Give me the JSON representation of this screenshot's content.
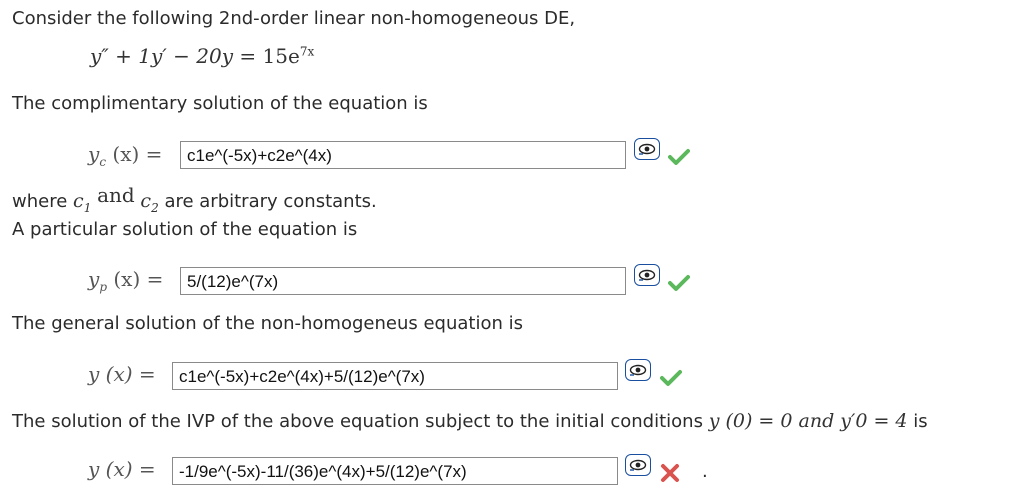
{
  "intro": "Consider the following 2nd-order linear non-homogeneous DE,",
  "de": {
    "lhs": "y″ + 1y′ − 20y",
    "eq": "=",
    "rhs_coeff": "15e",
    "rhs_exp": "7x"
  },
  "complementary": {
    "prompt": "The complimentary solution of the equation is",
    "lhs_main": "y",
    "lhs_sub": "c",
    "lhs_arg": "(x) =",
    "value": "c1e^(-5x)+c2e^(4x)",
    "status": "correct"
  },
  "constants": {
    "where": "where",
    "c1": "c",
    "c1_sub": "1",
    "and": "and",
    "c2": "c",
    "c2_sub": "2",
    "tail": "are arbitrary constants."
  },
  "particular": {
    "prompt": "A particular solution of the equation is",
    "lhs_main": "y",
    "lhs_sub": "p",
    "lhs_arg": "(x) =",
    "value": "5/(12)e^(7x)",
    "status": "correct"
  },
  "general": {
    "prompt": "The general solution of the non-homogeneus equation is",
    "lhs": "y (x) =",
    "value": "c1e^(-5x)+c2e^(4x)+5/(12)e^(7x)",
    "status": "correct"
  },
  "ivp": {
    "prompt": "The solution of the IVP of the above equation subject to the initial conditions",
    "conditions": "y (0) = 0 and y′0 = 4",
    "tail": "is",
    "lhs": "y (x) =",
    "value": "-1/9e^(-5x)-11/(36)e^(4x)+5/(12)e^(7x)",
    "status": "incorrect",
    "period": "."
  },
  "colors": {
    "correct": "#5cb85c",
    "incorrect": "#d9534f",
    "preview_border": "#1a4fa0"
  },
  "icons": {
    "preview": "eye-preview-icon",
    "correct": "checkmark-icon",
    "incorrect": "x-mark-icon"
  }
}
